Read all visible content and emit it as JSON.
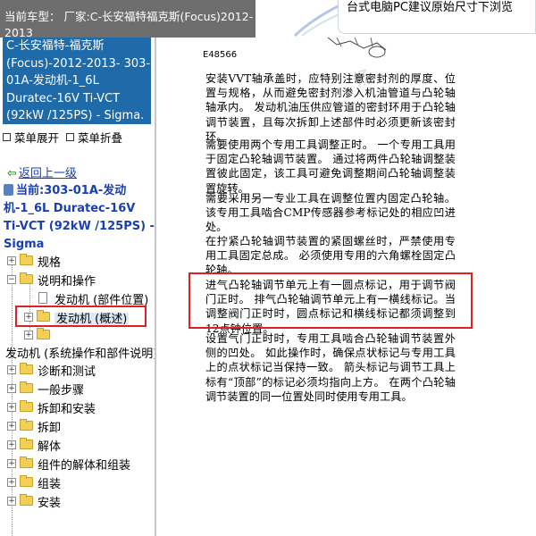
{
  "banner": {
    "model_label": "当前车型：",
    "model_value": "厂家:C-长安福特福克斯(Focus)2012-2013",
    "hint": "台式电脑PC建议原始尺寸下浏览"
  },
  "sidebar": {
    "title": "C-长安福特-福克斯(Focus)-2012-2013- 303-01A-发动机-1_6L Duratec-16V Ti-VCT (92kW /125PS) - Sigma.",
    "expand_label": "菜单展开",
    "collapse_label": "菜单折叠",
    "back_label": "返回上一级",
    "current": "当前:303-01A-发动机-1_6L Duratec-16V Ti-VCT (92kW /125PS) - Sigma",
    "tree": [
      {
        "label": "规格"
      },
      {
        "label": "说明和操作"
      },
      {
        "label": "发动机 (部件位置)"
      },
      {
        "label": "发动机 (概述)"
      },
      {
        "label": ""
      },
      {
        "label": "发动机 (系统操作和部件说明)"
      },
      {
        "label": "诊断和测试"
      },
      {
        "label": "一般步骤"
      },
      {
        "label": "拆卸和安装"
      },
      {
        "label": "拆卸"
      },
      {
        "label": "解体"
      },
      {
        "label": "组件的解体和组装"
      },
      {
        "label": "组装"
      },
      {
        "label": "安装"
      }
    ]
  },
  "content": {
    "figure_code": "E48566",
    "paragraphs": [
      "安装VVT轴承盖时，应特别注意密封剂的厚度、位置与规格，从而避免密封剂渗入机油管道与凸轮轴轴承内。 发动机油压供应管道的密封环用于凸轮轴调节装置，且每次拆卸上述部件时必须更新该密封环。",
      "需要使用两个专用工具调整正时。 一个专用工具用于固定凸轮轴调节装置。 通过将两件凸轮轴调整装置彼此固定，该工具可避免调整期间凸轮轴调整装置旋转。",
      "需要采用另一专业工具在调整位置内固定凸轮轴。该专用工具啮合CMP传感器参考标记处的相应凹进处。",
      "在拧紧凸轮轴调节装置的紧固螺丝时，严禁使用专用工具固定总成。 必须使用专用的六角螺栓固定凸轮轴。",
      "进气凸轮轴调节单元上有一圆点标记，用于调节阀门正时。 排气凸轮轴调节单元上有一横线标记。当调整阀门正时时，圆点标记和横线标记都须调整到12点钟位置。",
      "设置气门正时时，专用工具啮合凸轮轴调节装置外侧的凹处。 如此操作时，确保点状标记与专用工具上的点状标记当保持一致。 箭头标记与调节工具上标有“顶部”的标记必须均指向上方。 在两个凸轮轴调节装置的同一位置处同时使用专用工具。"
    ]
  }
}
